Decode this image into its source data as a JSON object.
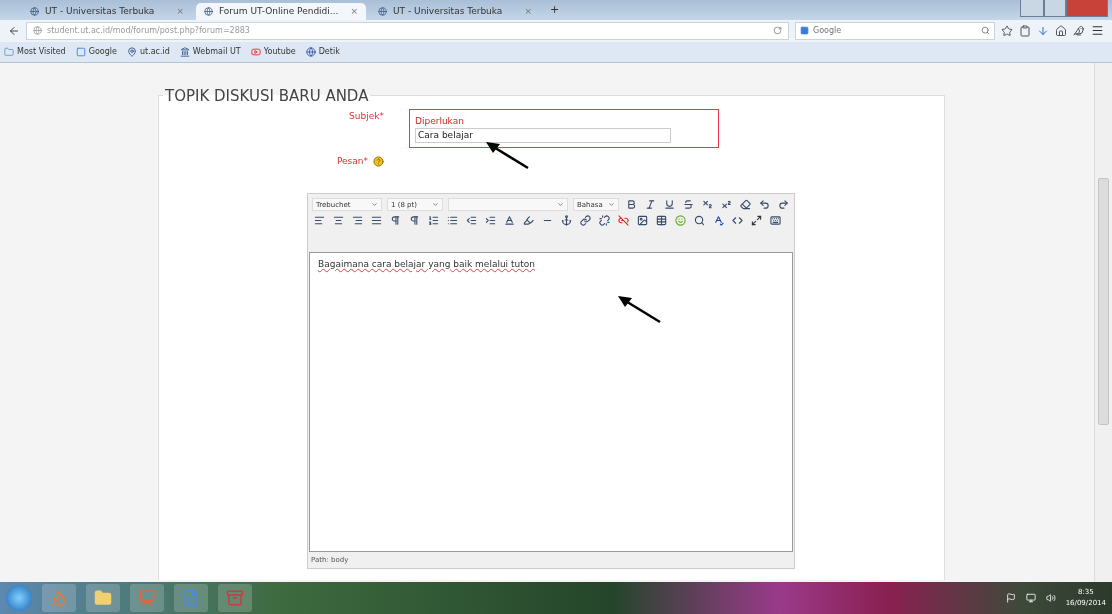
{
  "browser": {
    "tabs": [
      {
        "label": "UT - Universitas Terbuka",
        "close": "×",
        "selected": false
      },
      {
        "label": "Forum UT-Online Pendidi...",
        "close": "×",
        "selected": true
      },
      {
        "label": "UT - Universitas Terbuka",
        "close": "×",
        "selected": false
      }
    ],
    "new_tab": "+",
    "url": "student.ut.ac.id/mod/forum/post.php?forum=2883",
    "search_placeholder": "Google",
    "bookmarks": [
      {
        "label": "Most Visited",
        "kind": "folder"
      },
      {
        "label": "Google",
        "kind": "google"
      },
      {
        "label": "ut.ac.id",
        "kind": "ut"
      },
      {
        "label": "Webmail UT",
        "kind": "home"
      },
      {
        "label": "Youtube",
        "kind": "youtube"
      },
      {
        "label": "Detik",
        "kind": "globe"
      }
    ]
  },
  "form": {
    "heading": "TOPIK DISKUSI BARU ANDA",
    "subject": {
      "label": "Subjek*",
      "error": "Diperlukan",
      "value": "Cara belajar"
    },
    "message": {
      "label": "Pesan*"
    },
    "editor": {
      "font": "Trebuchet",
      "size": "1 (8 pt)",
      "language": "Bahasa",
      "buttons": [
        {
          "kind": "bold"
        },
        {
          "kind": "italic"
        },
        {
          "kind": "underline"
        },
        {
          "kind": "strike"
        },
        {
          "kind": "subscript"
        },
        {
          "kind": "superscript"
        },
        {
          "kind": "clean"
        },
        {
          "kind": "undo"
        },
        {
          "kind": "redo"
        },
        {
          "kind": "align-left"
        },
        {
          "kind": "align-center"
        },
        {
          "kind": "align-right"
        },
        {
          "kind": "justify"
        },
        {
          "kind": "ltr"
        },
        {
          "kind": "rtl"
        },
        {
          "kind": "ordered-list"
        },
        {
          "kind": "bullet-list"
        },
        {
          "kind": "outdent"
        },
        {
          "kind": "indent"
        },
        {
          "kind": "text-color"
        },
        {
          "kind": "back-color"
        },
        {
          "kind": "rule"
        },
        {
          "kind": "anchor"
        },
        {
          "kind": "link"
        },
        {
          "kind": "unlink"
        },
        {
          "kind": "nolink"
        },
        {
          "kind": "image"
        },
        {
          "kind": "table"
        },
        {
          "kind": "smiley"
        },
        {
          "kind": "search"
        },
        {
          "kind": "spell"
        },
        {
          "kind": "html"
        },
        {
          "kind": "fullscreen"
        },
        {
          "kind": "keyboard"
        }
      ],
      "content": "Bagaimana cara belajar yang baik melalui tuton",
      "path": "Path: body"
    }
  },
  "taskbar": {
    "time": "8:35",
    "date": "16/09/2014"
  }
}
